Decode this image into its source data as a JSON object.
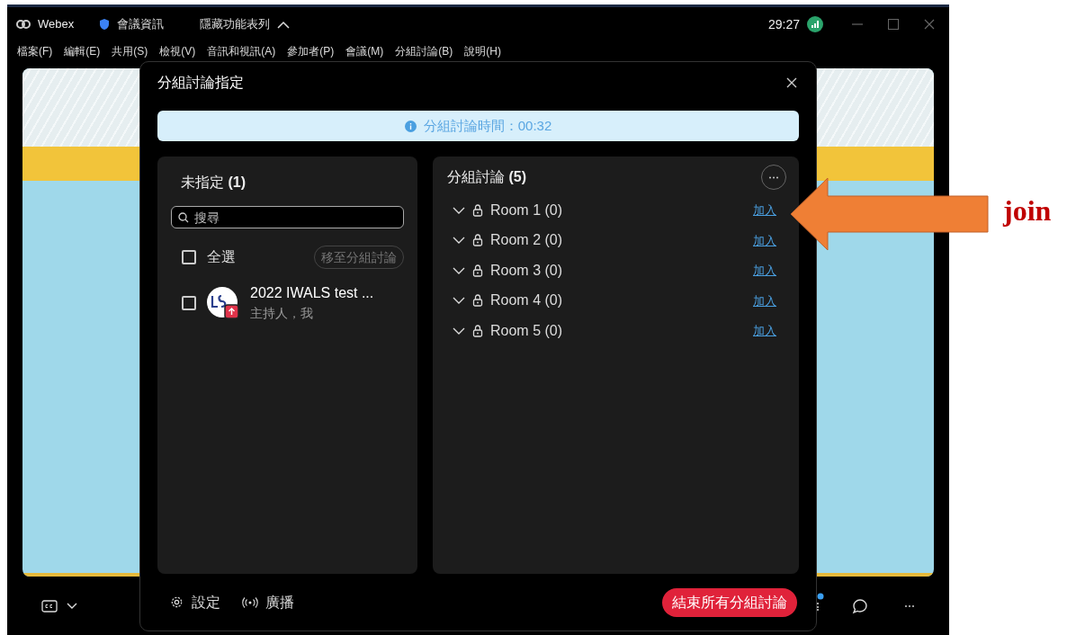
{
  "window": {
    "app_name": "Webex",
    "meeting_info": "會議資訊",
    "hide_menu": "隱藏功能表列",
    "timer": "29:27"
  },
  "menu": [
    "檔案(F)",
    "編輯(E)",
    "共用(S)",
    "檢視(V)",
    "音訊和視訊(A)",
    "參加者(P)",
    "會議(M)",
    "分組討論(B)",
    "說明(H)"
  ],
  "dialog": {
    "title": "分組討論指定",
    "banner": "分組討論時間：00:32",
    "unassigned": {
      "title": "未指定 **(1)**",
      "search": {
        "placeholder": "搜尋"
      },
      "select_all": {
        "label": "全選",
        "checked": false
      },
      "move_button": "移至分組討論",
      "participants": [
        {
          "name": "2022 IWALS test ...",
          "role": "主持人，我",
          "checked": false
        }
      ]
    },
    "rooms": {
      "title": "分組討論 **(5)**",
      "items": [
        {
          "name": "Room 1 (0)",
          "expanded": false,
          "join": "加入"
        },
        {
          "name": "Room 2 (0)",
          "expanded": false,
          "join": "加入"
        },
        {
          "name": "Room 3 (0)",
          "expanded": false,
          "join": "加入"
        },
        {
          "name": "Room 4 (0)",
          "expanded": false,
          "join": "加入"
        },
        {
          "name": "Room 5 (0)",
          "expanded": false,
          "join": "加入"
        }
      ]
    },
    "footer": {
      "settings": "設定",
      "broadcast": "廣播",
      "end_button": "結束所有分組討論"
    }
  },
  "annotation": {
    "label": "join"
  }
}
